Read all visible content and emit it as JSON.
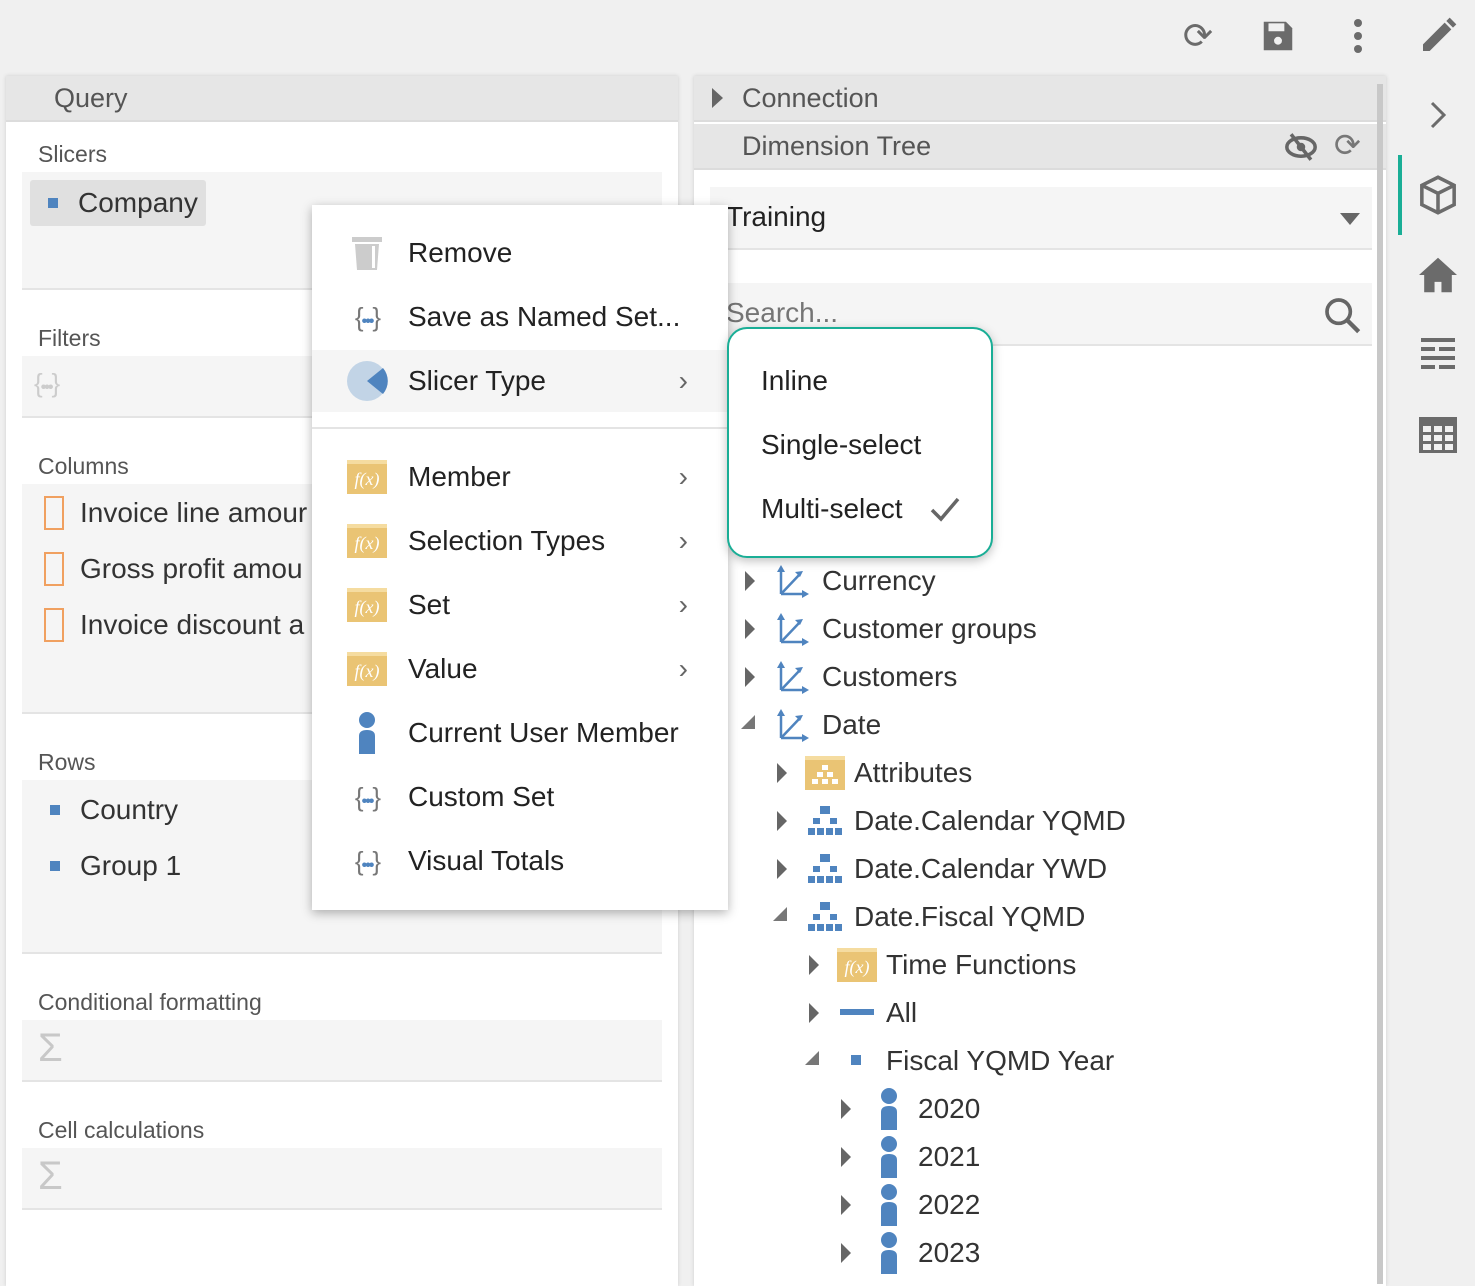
{
  "toolbar": {
    "icons": [
      "refresh-icon",
      "save-icon",
      "more-vertical-icon",
      "edit-icon"
    ]
  },
  "query": {
    "title": "Query",
    "slicers": {
      "label": "Slicers",
      "items": [
        "Company"
      ]
    },
    "filters": {
      "label": "Filters"
    },
    "columns": {
      "label": "Columns",
      "items": [
        "Invoice line amour",
        "Gross profit amou",
        "Invoice discount a"
      ]
    },
    "rows": {
      "label": "Rows",
      "items": [
        "Country",
        "Group 1"
      ]
    },
    "conditional_formatting": {
      "label": "Conditional formatting"
    },
    "cell_calculations": {
      "label": "Cell calculations"
    }
  },
  "context_menu": {
    "items": [
      {
        "label": "Remove",
        "icon": "trash-icon"
      },
      {
        "label": "Save as Named Set...",
        "icon": "named-set-icon"
      },
      {
        "label": "Slicer Type",
        "icon": "pie-icon",
        "submenu": true,
        "highlighted": true
      },
      {
        "label": "Member",
        "icon": "function-folder-icon",
        "submenu": true
      },
      {
        "label": "Selection Types",
        "icon": "function-folder-icon",
        "submenu": true
      },
      {
        "label": "Set",
        "icon": "function-folder-icon",
        "submenu": true
      },
      {
        "label": "Value",
        "icon": "function-folder-icon",
        "submenu": true
      },
      {
        "label": "Current User Member",
        "icon": "user-icon"
      },
      {
        "label": "Custom Set",
        "icon": "named-set-icon"
      },
      {
        "label": "Visual Totals",
        "icon": "named-set-icon"
      }
    ]
  },
  "slicer_type_menu": {
    "items": [
      "Inline",
      "Single-select",
      "Multi-select"
    ],
    "selected": "Multi-select"
  },
  "right_panel": {
    "connection": "Connection",
    "dimension_tree": "Dimension Tree",
    "cube_select": "Training",
    "search_placeholder": "Search...",
    "tree": [
      {
        "label": "Currency",
        "level": 0,
        "icon": "dimension-icon",
        "expanded": false
      },
      {
        "label": "Customer groups",
        "level": 0,
        "icon": "dimension-icon",
        "expanded": false
      },
      {
        "label": "Customers",
        "level": 0,
        "icon": "dimension-icon",
        "expanded": false
      },
      {
        "label": "Date",
        "level": 0,
        "icon": "dimension-icon",
        "expanded": true
      },
      {
        "label": "Attributes",
        "level": 1,
        "icon": "attribute-folder-icon",
        "expanded": false
      },
      {
        "label": "Date.Calendar YQMD",
        "level": 1,
        "icon": "hierarchy-icon",
        "expanded": false
      },
      {
        "label": "Date.Calendar YWD",
        "level": 1,
        "icon": "hierarchy-icon",
        "expanded": false
      },
      {
        "label": "Date.Fiscal YQMD",
        "level": 1,
        "icon": "hierarchy-icon",
        "expanded": true
      },
      {
        "label": "Time Functions",
        "level": 2,
        "icon": "function-folder-icon",
        "expanded": false
      },
      {
        "label": "All",
        "level": 2,
        "icon": "all-level-icon",
        "expanded": false
      },
      {
        "label": "Fiscal YQMD Year",
        "level": 2,
        "icon": "level-icon",
        "expanded": true
      },
      {
        "label": "2020",
        "level": 3,
        "icon": "member-icon",
        "expanded": false
      },
      {
        "label": "2021",
        "level": 3,
        "icon": "member-icon",
        "expanded": false
      },
      {
        "label": "2022",
        "level": 3,
        "icon": "member-icon",
        "expanded": false
      },
      {
        "label": "2023",
        "level": 3,
        "icon": "member-icon",
        "expanded": false
      }
    ]
  },
  "sidebar": {
    "icons": [
      "chevron-right-icon",
      "cube-icon",
      "home-icon",
      "list-icon",
      "table-icon"
    ],
    "active": "cube-icon"
  },
  "colors": {
    "accent": "#1aae96",
    "icon_blue": "#4f84bf",
    "folder": "#eac474"
  }
}
